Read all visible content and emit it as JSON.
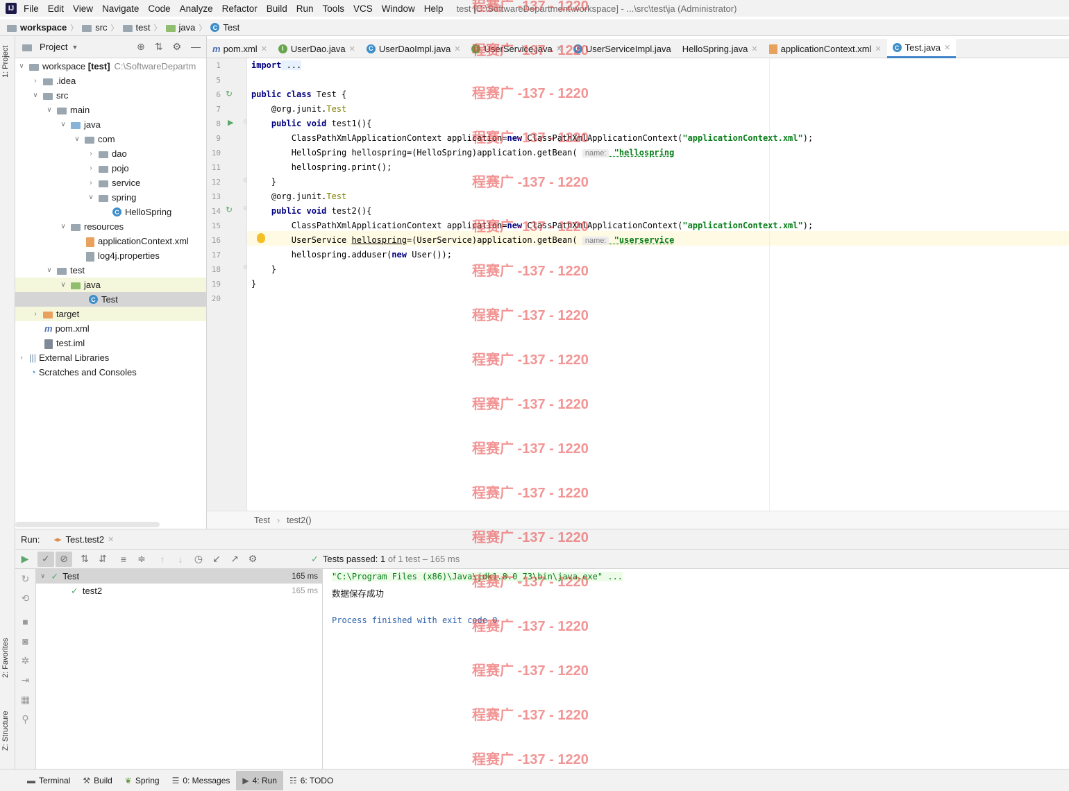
{
  "menubar": {
    "items": [
      "File",
      "Edit",
      "View",
      "Navigate",
      "Code",
      "Analyze",
      "Refactor",
      "Build",
      "Run",
      "Tools",
      "VCS",
      "Window",
      "Help"
    ],
    "title": "test [C:\\SoftwareDepartment\\workspace] - ...\\src\\test\\ja (Administrator)"
  },
  "navbar": {
    "crumbs": [
      "workspace",
      "src",
      "test",
      "java",
      "Test"
    ]
  },
  "left_strip": {
    "project": "1: Project",
    "favorites": "2: Favorites",
    "structure": "Z: Structure"
  },
  "project": {
    "header": "Project",
    "tree": [
      {
        "label": "workspace",
        "bold": "[test]",
        "path": "C:\\SoftwareDepartm"
      },
      {
        "label": ".idea"
      },
      {
        "label": "src"
      },
      {
        "label": "main"
      },
      {
        "label": "java"
      },
      {
        "label": "com"
      },
      {
        "label": "dao"
      },
      {
        "label": "pojo"
      },
      {
        "label": "service"
      },
      {
        "label": "spring"
      },
      {
        "label": "HelloSpring"
      },
      {
        "label": "resources"
      },
      {
        "label": "applicationContext.xml"
      },
      {
        "label": "log4j.properties"
      },
      {
        "label": "test"
      },
      {
        "label": "java"
      },
      {
        "label": "Test"
      },
      {
        "label": "target"
      },
      {
        "label": "pom.xml"
      },
      {
        "label": "test.iml"
      },
      {
        "label": "External Libraries"
      },
      {
        "label": "Scratches and Consoles"
      }
    ]
  },
  "editor": {
    "tabs": [
      "pom.xml",
      "UserDao.java",
      "UserDaoImpl.java",
      "UserService.java",
      "UserServiceImpl.java",
      "HelloSpring.java",
      "applicationContext.xml",
      "Test.java"
    ],
    "line_numbers": [
      "1",
      "5",
      "6",
      "7",
      "8",
      "9",
      "10",
      "11",
      "12",
      "13",
      "14",
      "15",
      "16",
      "17",
      "18",
      "19",
      "20"
    ],
    "code": {
      "l1a": "import",
      "l1b": " ...",
      "l6a": "public class",
      "l6b": " Test {",
      "l7a": "    @org.junit.",
      "l7b": "Test",
      "l8a": "    public void",
      "l8b": " test1(){",
      "l9a": "        ClassPathXmlApplicationContext application=",
      "l9b": "new",
      "l9c": " ClassPathXmlApplicationContext(",
      "l9d": "\"applicationContext.xml\"",
      "l9e": ");",
      "l10a": "        HelloSpring hellospring=(HelloSpring)application.getBean( ",
      "l10hint": "name:",
      "l10s": " \"hellospring",
      "l11": "        hellospring.print();",
      "l12": "    }",
      "l13a": "    @org.junit.",
      "l13b": "Test",
      "l14a": "    public void",
      "l14b": " test2(){",
      "l15a": "        ClassPathXmlApplicationContext application=",
      "l15b": "new",
      "l15c": " ClassPathXmlApplicationContext(",
      "l15d": "\"applicationContext.xml\"",
      "l15e": ");",
      "l16a": "        UserService ",
      "l16b": "hellospring",
      "l16c": "=(UserService)application.getBean( ",
      "l16hint": "name:",
      "l16s": " \"userservice",
      "l17a": "        hellospring.adduser(",
      "l17b": "new",
      "l17c": " User());",
      "l18": "    }",
      "l19": "}"
    },
    "breadcrumb": [
      "Test",
      "test2()"
    ]
  },
  "run": {
    "label": "Run:",
    "tab": "Test.test2",
    "status_prefix": "Tests passed:",
    "status_count": "1",
    "status_rest": "of 1 test – 165 ms",
    "tests": [
      {
        "name": "Test",
        "time": "165 ms"
      },
      {
        "name": "test2",
        "time": "165 ms"
      }
    ],
    "console": [
      "\"C:\\Program Files (x86)\\Java\\jdk1.8.0_73\\bin\\java.exe\" ...",
      "数据保存成功",
      "",
      "Process finished with exit code 0"
    ]
  },
  "statusbar": [
    "Terminal",
    "Build",
    "Spring",
    "0: Messages",
    "4: Run",
    "6: TODO"
  ],
  "watermark": "程赛广 -137 - 1220"
}
